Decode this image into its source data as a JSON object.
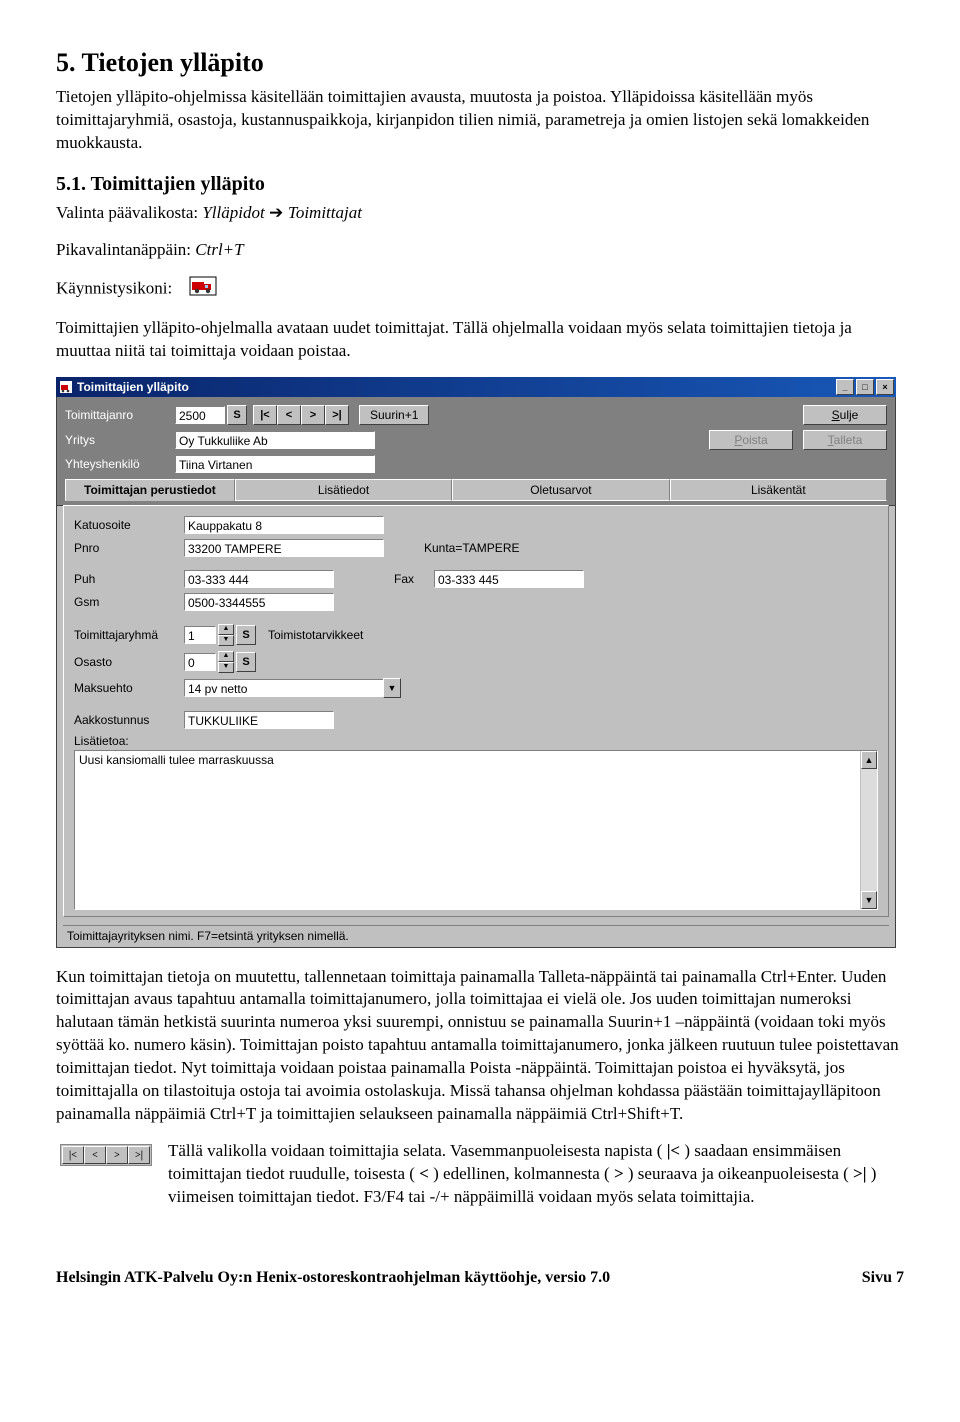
{
  "doc": {
    "h5": "5. Tietojen ylläpito",
    "p5": "Tietojen ylläpito-ohjelmissa käsitellään toimittajien avausta, muutosta ja poistoa. Ylläpidoissa käsitellään myös toimittajaryhmiä, osastoja, kustannuspaikkoja, kirjanpidon tilien nimiä, parametreja ja omien listojen sekä lomakkeiden muokkausta.",
    "h51": "5.1. Toimittajien ylläpito",
    "sel_label": "Valinta päävalikosta: ",
    "sel_value": "Ylläpidot ",
    "sel_arrow": "➔ ",
    "sel_value2": "Toimittajat",
    "shortcut_label": "Pikavalintanäppäin: ",
    "shortcut_value": "Ctrl+T",
    "launch_label": "Käynnistysikoni:",
    "p_intro": "Toimittajien ylläpito-ohjelmalla avataan uudet toimittajat. Tällä ohjelmalla voidaan myös selata toimittajien tietoja ja muuttaa niitä tai toimittaja voidaan poistaa.",
    "p_after": "Kun toimittajan tietoja on muutettu, tallennetaan toimittaja painamalla Talleta-näppäintä tai painamalla Ctrl+Enter. Uuden toimittajan avaus tapahtuu antamalla toimittajanumero, jolla toimittajaa ei vielä ole. Jos uuden toimittajan numeroksi halutaan tämän hetkistä suurinta numeroa yksi suurempi, onnistuu se painamalla Suurin+1 –näppäintä (voidaan toki myös syöttää ko. numero käsin). Toimittajan poisto tapahtuu antamalla toimittajanumero, jonka jälkeen ruutuun tulee poistettavan toimittajan tiedot. Nyt toimittaja voidaan poistaa painamalla Poista -näppäintä. Toimittajan poistoa ei hyväksytä, jos toimittajalla on tilastoituja ostoja tai avoimia ostolaskuja. Missä tahansa ohjelman kohdassa päästään toimittajaylläpitoon painamalla näppäimiä Ctrl+T ja toimittajien selaukseen painamalla näppäimiä Ctrl+Shift+T.",
    "p_nav1": "Tällä valikolla voidaan toimittajia selata. Vasemmanpuoleisesta napista (",
    "p_nav_first_sym": "|<",
    "p_nav2": ") saadaan ensimmäisen toimittajan tiedot ruudulle, toisesta (",
    "p_nav_prev_sym": "<",
    "p_nav3": ") edellinen, kolmannesta (",
    "p_nav_next_sym": ">",
    "p_nav4": ") seuraava ja oikeanpuoleisesta (",
    "p_nav_last_sym": ">|",
    "p_nav5": ") viimeisen toimittajan tiedot. F3/F4 tai -/+ näppäimillä voidaan myös selata toimittajia."
  },
  "win": {
    "title": "Toimittajien ylläpito",
    "labels": {
      "nro": "Toimittajanro",
      "yritys": "Yritys",
      "yhteys": "Yhteyshenkilö",
      "katu": "Katuosoite",
      "pnro": "Pnro",
      "kunta": "Kunta=TAMPERE",
      "puh": "Puh",
      "fax": "Fax",
      "gsm": "Gsm",
      "ryhma": "Toimittajaryhmä",
      "ryhma_text": "Toimistotarvikkeet",
      "osasto": "Osasto",
      "maksu": "Maksuehto",
      "akk": "Aakkostunnus",
      "lisa": "Lisätietoa:"
    },
    "values": {
      "nro": "2500",
      "yritys": "Oy Tukkuliike Ab",
      "yhteys": "Tiina Virtanen",
      "katu": "Kauppakatu 8",
      "pnro": "33200 TAMPERE",
      "puh": "03-333 444",
      "fax": "03-333 445",
      "gsm": "0500-3344555",
      "ryhma": "1",
      "osasto": "0",
      "maksu": "14 pv netto",
      "akk": "TUKKULIIKE",
      "lisatieto": "Uusi kansiomalli tulee marraskuussa"
    },
    "buttons": {
      "suurin": "Suurin+1",
      "sulje": "Sulje",
      "poista": "Poista",
      "talleta": "Talleta"
    },
    "tabs": {
      "t1": "Toimittajan perustiedot",
      "t2": "Lisätiedot",
      "t3": "Oletusarvot",
      "t4": "Lisäkentät"
    },
    "nav": {
      "first": "|<",
      "prev": "<",
      "next": ">",
      "last": ">|"
    },
    "status": "Toimittajayrityksen nimi. F7=etsintä yrityksen nimellä."
  },
  "footer": {
    "left": "Helsingin ATK-Palvelu Oy:n Henix-ostoreskontraohjelman käyttöohje, versio 7.0",
    "right": "Sivu 7"
  }
}
